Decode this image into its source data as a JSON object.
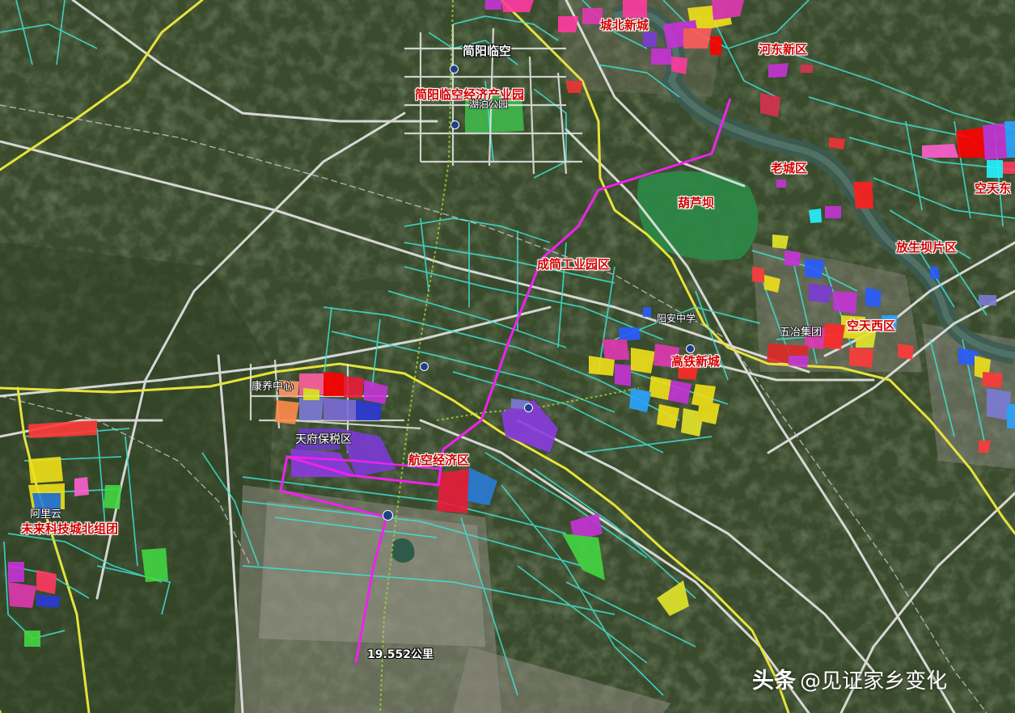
{
  "map": {
    "labels": [
      {
        "name": "label-jianyang-linkong",
        "text": "简阳临空",
        "style": "wbold"
      },
      {
        "name": "label-jianyang-airport-economic-park",
        "text": "简阳临空经济产业园",
        "style": "red"
      },
      {
        "name": "label-shihu-park",
        "text": "湖泊公园",
        "style": "white"
      },
      {
        "name": "label-chengbei-new-town",
        "text": "城北新城",
        "style": "red"
      },
      {
        "name": "label-hedong-new-area",
        "text": "河东新区",
        "style": "red"
      },
      {
        "name": "label-old-town",
        "text": "老城区",
        "style": "red"
      },
      {
        "name": "label-huluba",
        "text": "葫芦坝",
        "style": "red"
      },
      {
        "name": "label-kongtiandong",
        "text": "空天东",
        "style": "red"
      },
      {
        "name": "label-fangshengba-area",
        "text": "放生坝片区",
        "style": "red"
      },
      {
        "name": "label-chengjian-industrial-park",
        "text": "成简工业园区",
        "style": "red"
      },
      {
        "name": "label-yangan-middle-school",
        "text": "阳安中学",
        "style": "white"
      },
      {
        "name": "label-highspeed-rail-new-town",
        "text": "高铁新城",
        "style": "red"
      },
      {
        "name": "label-kongtianxi",
        "text": "空天西区",
        "style": "red"
      },
      {
        "name": "label-wuye-group",
        "text": "五冶集团",
        "style": "white"
      },
      {
        "name": "label-kangyang-center",
        "text": "康养中心",
        "style": "white"
      },
      {
        "name": "label-tianfu-bonded-zone",
        "text": "天府保税区",
        "style": "white"
      },
      {
        "name": "label-aviation-economic-zone",
        "text": "航空经济区",
        "style": "red"
      },
      {
        "name": "label-alibaba-cloud",
        "text": "阿里云",
        "style": "white"
      },
      {
        "name": "label-future-tech-city-north",
        "text": "未来科技城北组团",
        "style": "red"
      }
    ],
    "measurement": {
      "distance": "19.552公里"
    }
  },
  "watermark": {
    "platform": "头条",
    "account": "@见证家乡变化"
  }
}
